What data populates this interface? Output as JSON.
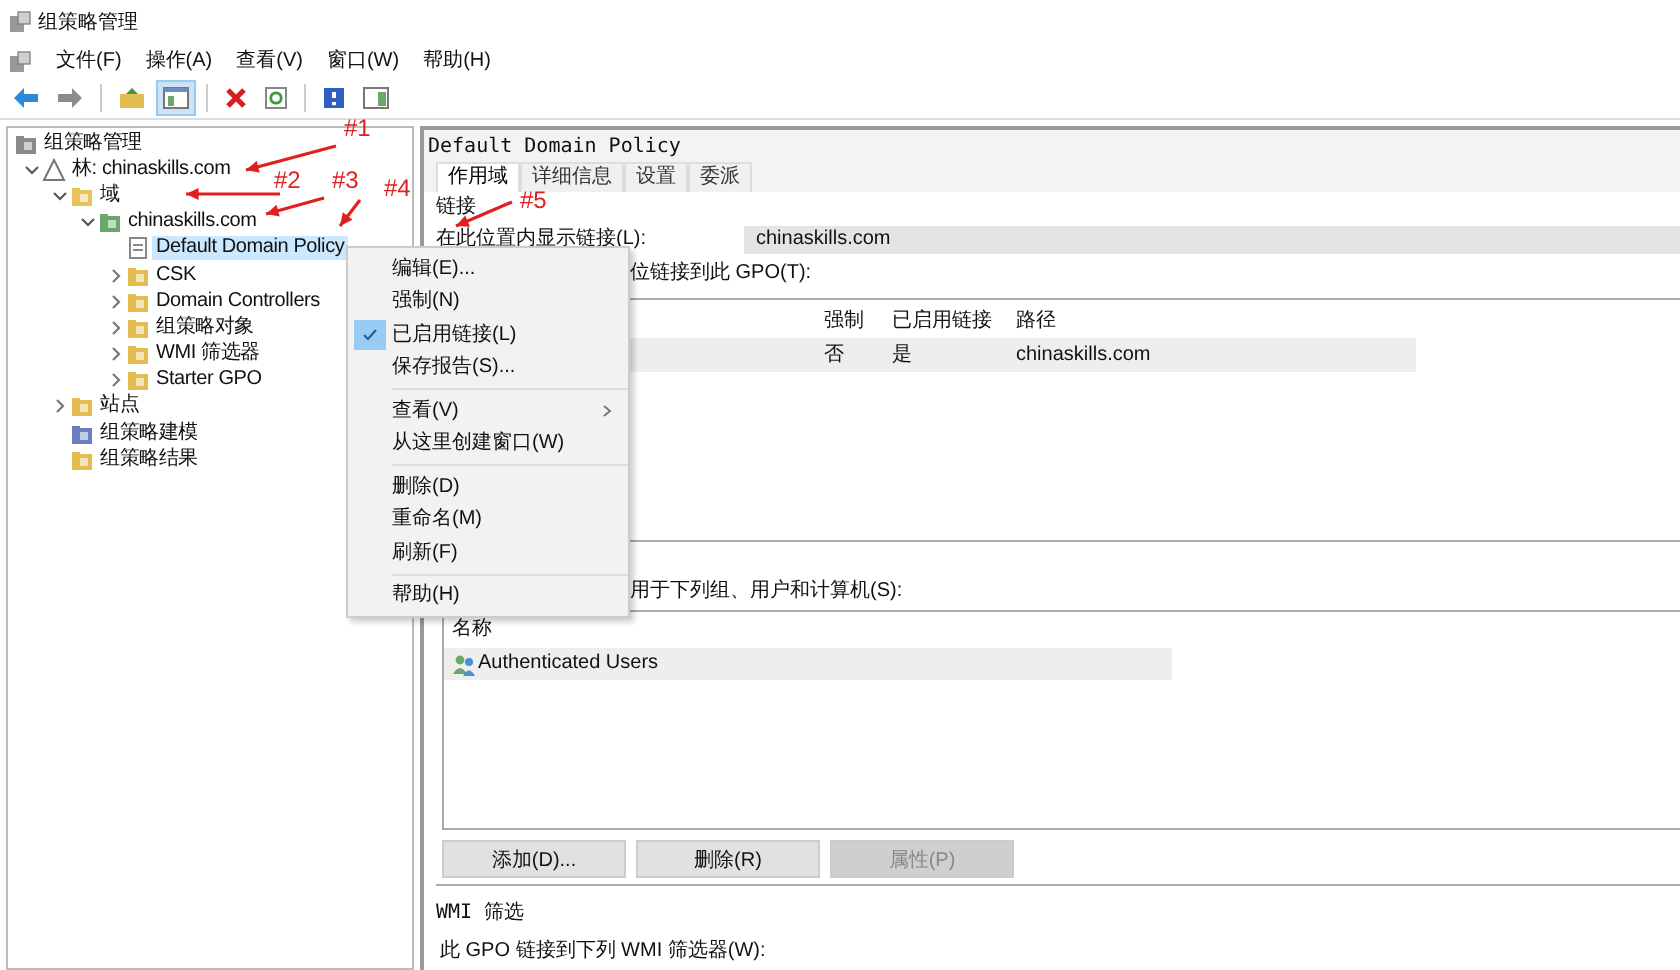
{
  "window": {
    "title": "组策略管理"
  },
  "menu_bar": [
    "文件(F)",
    "操作(A)",
    "查看(V)",
    "窗口(W)",
    "帮助(H)"
  ],
  "toolbar": [
    {
      "kind": "back",
      "selected": false
    },
    {
      "kind": "forward",
      "selected": false
    },
    {
      "kind": "up",
      "selected": false
    },
    {
      "kind": "tree",
      "selected": true
    },
    {
      "kind": "delete",
      "selected": false
    },
    {
      "kind": "refresh",
      "selected": false
    },
    {
      "kind": "help",
      "selected": false
    },
    {
      "kind": "pane",
      "selected": false
    }
  ],
  "tree": [
    {
      "label": "组策略管理",
      "kind": "console",
      "selected": false,
      "children": [
        {
          "label": "林: chinaskills.com",
          "kind": "forest",
          "expanded": true,
          "selected": false,
          "children": [
            {
              "label": "域",
              "kind": "domains",
              "expanded": true,
              "selected": false,
              "children": [
                {
                  "label": "chinaskills.com",
                  "kind": "domain",
                  "expanded": true,
                  "selected": false,
                  "children": [
                    {
                      "label": "Default Domain Policy",
                      "kind": "gpo",
                      "selected": true
                    },
                    {
                      "label": "CSK",
                      "kind": "ou",
                      "expanded": false,
                      "selected": false
                    },
                    {
                      "label": "Domain Controllers",
                      "kind": "ou",
                      "expanded": false,
                      "selected": false
                    },
                    {
                      "label": "组策略对象",
                      "kind": "folder",
                      "expanded": false,
                      "selected": false
                    },
                    {
                      "label": "WMI 筛选器",
                      "kind": "filter",
                      "expanded": false,
                      "selected": false
                    },
                    {
                      "label": "Starter GPO",
                      "kind": "starter",
                      "expanded": false,
                      "selected": false
                    }
                  ]
                }
              ]
            },
            {
              "label": "站点",
              "kind": "sites",
              "expanded": false,
              "selected": false
            },
            {
              "label": "组策略建模",
              "kind": "modeling",
              "selected": false
            },
            {
              "label": "组策略结果",
              "kind": "results",
              "selected": false
            }
          ]
        }
      ]
    }
  ],
  "details": {
    "title": "Default Domain Policy",
    "tabs": [
      {
        "label": "作用域",
        "selected": true
      },
      {
        "label": "详细信息",
        "selected": false
      },
      {
        "label": "设置",
        "selected": false
      },
      {
        "label": "委派",
        "selected": false
      }
    ],
    "links": {
      "heading": "链接",
      "location_label": "在此位置内显示链接(L):",
      "location_value": "chinaskills.com",
      "linked_label": "位链接到此 GPO(T):",
      "columns": [
        "强制",
        "已启用链接",
        "路径"
      ],
      "rows": [
        {
          "cells": [
            "否",
            "是",
            "chinaskills.com"
          ],
          "selected": true
        }
      ]
    },
    "security": {
      "label": "用于下列组、用户和计算机(S):",
      "column": "名称",
      "rows": [
        {
          "name": "Authenticated Users",
          "selected": true
        }
      ],
      "buttons": [
        {
          "label": "添加(D)...",
          "disabled": false
        },
        {
          "label": "删除(R)",
          "disabled": false
        },
        {
          "label": "属性(P)",
          "disabled": true
        }
      ]
    },
    "wmi": {
      "heading": "WMI 筛选",
      "label": "此 GPO 链接到下列 WMI 筛选器(W):"
    }
  },
  "context_menu": [
    {
      "kind": "item",
      "label": "编辑(E)...",
      "checked": false
    },
    {
      "kind": "item",
      "label": "强制(N)",
      "checked": false
    },
    {
      "kind": "item",
      "label": "已启用链接(L)",
      "checked": true
    },
    {
      "kind": "item",
      "label": "保存报告(S)...",
      "checked": false
    },
    {
      "kind": "separator"
    },
    {
      "kind": "submenu",
      "label": "查看(V)",
      "checked": false
    },
    {
      "kind": "item",
      "label": "从这里创建窗口(W)",
      "checked": false
    },
    {
      "kind": "separator"
    },
    {
      "kind": "item",
      "label": "删除(D)",
      "checked": false
    },
    {
      "kind": "item",
      "label": "重命名(M)",
      "checked": false
    },
    {
      "kind": "item",
      "label": "刷新(F)",
      "checked": false
    },
    {
      "kind": "separator"
    },
    {
      "kind": "item",
      "label": "帮助(H)",
      "checked": false
    }
  ],
  "annotations": [
    {
      "label": "#1"
    },
    {
      "label": "#2"
    },
    {
      "label": "#3"
    },
    {
      "label": "#4"
    },
    {
      "label": "#5"
    }
  ]
}
